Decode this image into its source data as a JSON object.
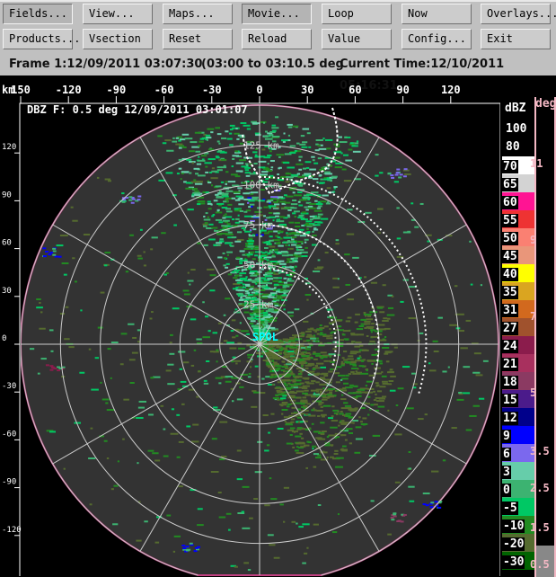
{
  "toolbar": {
    "row1": [
      "Fields...",
      "View...",
      "Maps...",
      "Movie...",
      "Loop",
      "Now",
      "Overlays..."
    ],
    "row2": [
      "Products...",
      "Vsection",
      "Reset",
      "Reload",
      "Value",
      "Config...",
      "Exit"
    ]
  },
  "status": {
    "frame": "Frame 1:12/09/2011 03:07:30",
    "range": "(03:00 to 03:10.5 deg",
    "current": "Current Time:12/10/2011 05:16:31"
  },
  "plot": {
    "title": "DBZ F: 0.5 deg 12/09/2011 03:01:07",
    "radar_name": "SPOL",
    "km_label": "km",
    "x_ticks": [
      "150",
      "-120",
      "-90",
      "-60",
      "-30",
      "0",
      "30",
      "60",
      "90",
      "120"
    ],
    "y_ticks": [
      "120",
      "90",
      "60",
      "30",
      "0",
      "-30",
      "-60",
      "-90",
      "-120"
    ],
    "ring_labels": [
      "25 km",
      "50 km",
      "75 km",
      "100 km",
      "125 km"
    ]
  },
  "scale": {
    "unit": "dBZ",
    "top_labels": [
      "100",
      "80"
    ],
    "levels": [
      {
        "label": "70",
        "color": "#ffffff"
      },
      {
        "label": "65",
        "color": "#d3d3d3"
      },
      {
        "label": "60",
        "color": "#ff1493"
      },
      {
        "label": "55",
        "color": "#ee3333"
      },
      {
        "label": "50",
        "color": "#fa8072"
      },
      {
        "label": "45",
        "color": "#e9967a"
      },
      {
        "label": "40",
        "color": "#ffff00"
      },
      {
        "label": "35",
        "color": "#daa520"
      },
      {
        "label": "31",
        "color": "#d2691e"
      },
      {
        "label": "27",
        "color": "#a0522d"
      },
      {
        "label": "24",
        "color": "#8b1c4c"
      },
      {
        "label": "21",
        "color": "#a8305e"
      },
      {
        "label": "18",
        "color": "#8b3a62"
      },
      {
        "label": "15",
        "color": "#4b1b8b"
      },
      {
        "label": "12",
        "color": "#00008b"
      },
      {
        "label": "9",
        "color": "#0000ff"
      },
      {
        "label": "6",
        "color": "#7b68ee"
      },
      {
        "label": "3",
        "color": "#66cdaa"
      },
      {
        "label": "0",
        "color": "#3cb371"
      },
      {
        "label": "-5",
        "color": "#00c864"
      },
      {
        "label": "-10",
        "color": "#228b22"
      },
      {
        "label": "-20",
        "color": "#556b2f"
      },
      {
        "label": "-30",
        "color": "#006400"
      }
    ]
  },
  "deg_scale": {
    "unit": "deg",
    "labels": [
      "11",
      "9",
      "7",
      "5",
      "3.5",
      "2.5",
      "1.5",
      "0.5"
    ]
  }
}
